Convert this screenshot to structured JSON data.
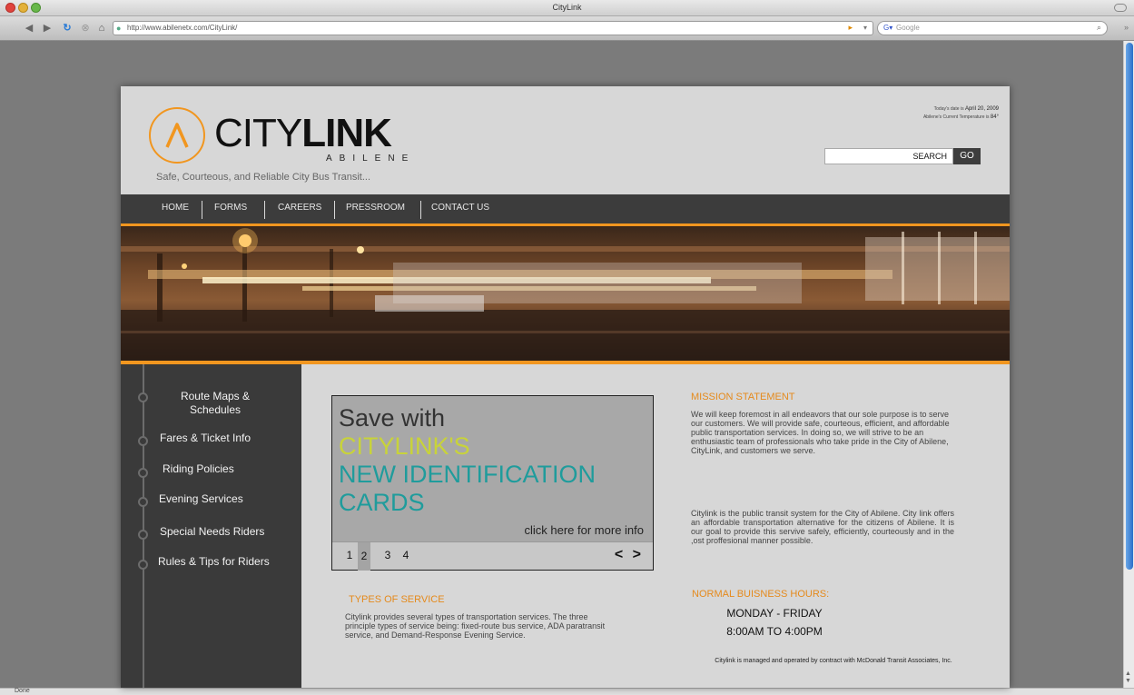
{
  "browser": {
    "window_title": "CityLink",
    "address": "http://www.abilenetx.com/CityLink/",
    "search_placeholder": "Google",
    "status": "Done"
  },
  "header": {
    "logo_city": "CITY",
    "logo_link": "LINK",
    "logo_sub": "ABILENE",
    "tagline": "Safe, Courteous, and Reliable City Bus Transit...",
    "date_prefix": "Today's date is",
    "date_value": "April 20, 2009",
    "temp_prefix": "Abilene's Current Temperature is",
    "temp_value": "84°",
    "search_label": "SEARCH",
    "search_go": "GO"
  },
  "nav": {
    "items": [
      "HOME",
      "FORMS",
      "CAREERS",
      "PRESSROOM",
      "CONTACT US"
    ]
  },
  "sidebar": {
    "items": [
      "Route Maps &",
      "Schedules",
      "Fares & Ticket Info",
      "Riding Policies",
      "Evening Services",
      "Special Needs Riders",
      "Rules & Tips for Riders"
    ]
  },
  "slider": {
    "line1": "Save with",
    "line2": "CITYLINK'S",
    "line3": "NEW IDENTIFICATION",
    "line4": "CARDS",
    "cta": "click here for more info",
    "pages": [
      "1",
      "2",
      "3",
      "4"
    ],
    "active_page": 2,
    "arrows": "< >"
  },
  "types": {
    "heading": "TYPES OF SERVICE",
    "text": "Citylink provides several types of transportation services. The three principle types of service being: fixed-route bus service, ADA paratransit service, and Demand-Response Evening Service."
  },
  "mission": {
    "heading": "MISSION STATEMENT",
    "text": "We will keep foremost in all endeavors that our sole purpose is to serve our customers. We will provide safe, courteous, efficient, and affordable public transportation services. In doing so, we will strive to be an enthusiastic team of professionals who take pride in the City of Abilene, CityLink, and customers we serve.",
    "about": "Citylink is the public transit system for the City of Abilene. City link offers an affordable transportation alternative for the citizens of Abilene. It is  our goal to provide this servive safely, efficiently, courteously and in the ,ost proffesional manner possible."
  },
  "hours": {
    "heading": "NORMAL BUISNESS HOURS:",
    "days": "MONDAY - FRIDAY",
    "times": "8:00AM TO 4:00PM"
  },
  "footer": {
    "note": "Citylink is managed and operated by contract with McDonald Transit Associates, Inc."
  },
  "colors": {
    "accent": "#f1961f",
    "nav_bg": "#3c3c3c",
    "teal": "#1f9c9c",
    "lime": "#c8d33a"
  }
}
